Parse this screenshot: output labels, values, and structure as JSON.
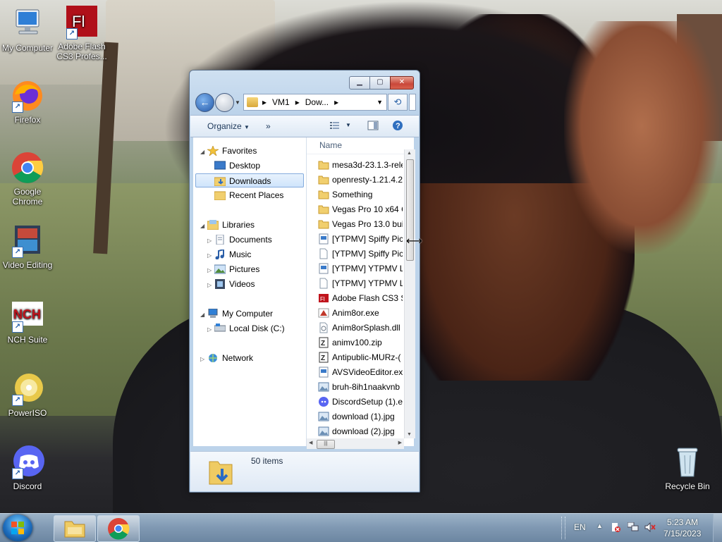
{
  "desktop": {
    "icons": [
      {
        "label": "My Computer"
      },
      {
        "label": "Adobe Flash CS3 Profes..."
      },
      {
        "label": "Firefox"
      },
      {
        "label": "Google Chrome"
      },
      {
        "label": "Video Editing"
      },
      {
        "label": "NCH Suite"
      },
      {
        "label": "PowerISO"
      },
      {
        "label": "Discord"
      },
      {
        "label": "Recycle Bin"
      }
    ]
  },
  "explorer": {
    "address": {
      "crumbs": [
        "VM1",
        "Dow..."
      ]
    },
    "toolbar": {
      "organize": "Organize",
      "more": "»"
    },
    "nav": {
      "favorites": "Favorites",
      "desktop": "Desktop",
      "downloads": "Downloads",
      "recent": "Recent Places",
      "libraries": "Libraries",
      "documents": "Documents",
      "music": "Music",
      "pictures": "Pictures",
      "videos": "Videos",
      "computer": "My Computer",
      "localdisk": "Local Disk (C:)",
      "network": "Network"
    },
    "column_header": "Name",
    "files": [
      {
        "name": "mesa3d-23.1.3-rele",
        "type": "folder"
      },
      {
        "name": "openresty-1.21.4.2",
        "type": "folder"
      },
      {
        "name": "Something",
        "type": "folder"
      },
      {
        "name": "Vegas Pro 10 x64 C",
        "type": "folder"
      },
      {
        "name": "Vegas Pro 13.0 bui",
        "type": "folder"
      },
      {
        "name": "[YTPMV] Spiffy Pic",
        "type": "exe"
      },
      {
        "name": "[YTPMV] Spiffy Pic",
        "type": "file"
      },
      {
        "name": "[YTPMV] YTPMV L",
        "type": "exe"
      },
      {
        "name": "[YTPMV] YTPMV L",
        "type": "file"
      },
      {
        "name": "Adobe Flash CS3 S",
        "type": "flash"
      },
      {
        "name": "Anim8or.exe",
        "type": "anim8or"
      },
      {
        "name": "Anim8orSplash.dll",
        "type": "dll"
      },
      {
        "name": "animv100.zip",
        "type": "zip"
      },
      {
        "name": "Antipublic-MURz-(",
        "type": "zip"
      },
      {
        "name": "AVSVideoEditor.ex",
        "type": "exe"
      },
      {
        "name": "bruh-8ih1naakvnb",
        "type": "image"
      },
      {
        "name": "DiscordSetup (1).e",
        "type": "discord"
      },
      {
        "name": "download (1).jpg",
        "type": "image"
      },
      {
        "name": "download (2).jpg",
        "type": "image"
      }
    ],
    "status": {
      "count": "50 items"
    }
  },
  "taskbar": {
    "lang": "EN",
    "time": "5:23 AM",
    "date": "7/15/2023"
  }
}
